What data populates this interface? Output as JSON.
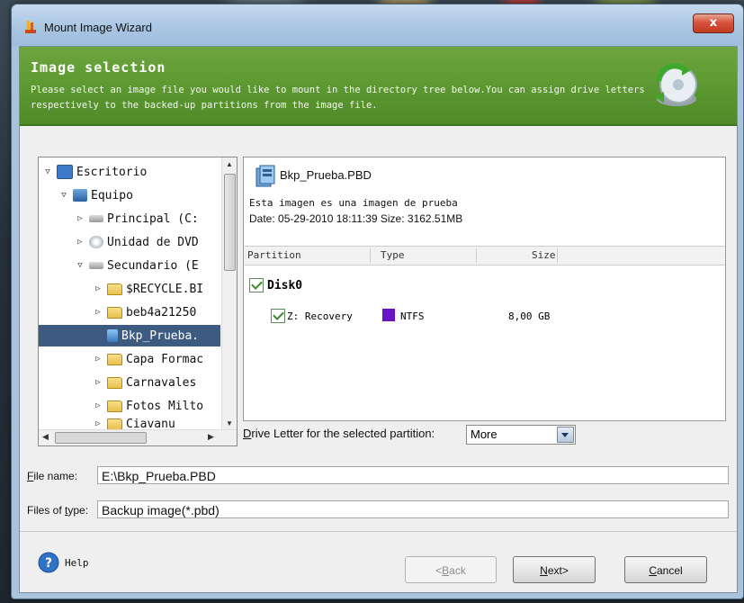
{
  "window": {
    "title": "Mount Image Wizard",
    "close_glyph": "x"
  },
  "banner": {
    "title": "Image selection",
    "description": "Please select an image file you would like to mount in the directory tree below.You can assign drive letters respectively to the backed-up partitions from the image file.",
    "icon": "disc-refresh-icon"
  },
  "tree": {
    "items": [
      {
        "label": "Escritorio",
        "icon": "desktop-icon"
      },
      {
        "label": "Equipo",
        "icon": "computer-icon"
      },
      {
        "label": "Principal (C:",
        "icon": "drive-icon"
      },
      {
        "label": "Unidad de DVD",
        "icon": "dvd-icon"
      },
      {
        "label": "Secundario (E",
        "icon": "drive-icon"
      },
      {
        "label": "$RECYCLE.BI",
        "icon": "folder-icon"
      },
      {
        "label": "beb4a21250",
        "icon": "folder-icon"
      },
      {
        "label": "Bkp_Prueba.",
        "icon": "image-file-icon",
        "selected": true
      },
      {
        "label": "Capa Formac",
        "icon": "folder-icon"
      },
      {
        "label": "Carnavales",
        "icon": "folder-icon"
      },
      {
        "label": "Fotos Milto",
        "icon": "folder-icon"
      },
      {
        "label": "Ciavanu",
        "icon": "folder-icon"
      }
    ]
  },
  "image_info": {
    "name": "Bkp_Prueba.PBD",
    "description": "Esta imagen es una imagen de prueba",
    "details": "Date: 05-29-2010 18:11:39 Size: 3162.51MB"
  },
  "partition_table": {
    "headers": [
      "Partition",
      "Type",
      "Size"
    ],
    "disk": "Disk0",
    "partitions": [
      {
        "name": "Z: Recovery",
        "type": "NTFS",
        "size": "8,00 GB",
        "checked": true,
        "color": "#6a12c8"
      }
    ]
  },
  "drive_letter": {
    "label": "Drive Letter for the selected partition:",
    "underline_char": "D",
    "value": "More"
  },
  "file_name": {
    "label_u": "F",
    "label_rest": "ile name:",
    "value": "E:\\Bkp_Prueba.PBD"
  },
  "file_type": {
    "label_pre": "Files of ",
    "label_u": "t",
    "label_rest": "ype:",
    "value": "Backup image(*.pbd)"
  },
  "buttons": {
    "help": "Help",
    "back_pre": "<",
    "back_u": "B",
    "back_rest": "ack",
    "next_u": "N",
    "next_rest": "ext>",
    "cancel_u": "C",
    "cancel_rest": "ancel"
  },
  "colors": {
    "banner": "#5a962f",
    "selection": "#3d5a80",
    "ntfs": "#6a12c8"
  }
}
